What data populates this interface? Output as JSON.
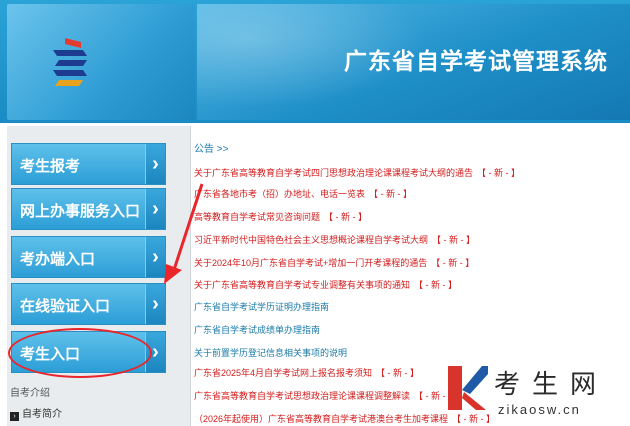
{
  "header": {
    "title": "广东省自学考试管理系统"
  },
  "sidebar": {
    "buttons": [
      {
        "label": "考生报考"
      },
      {
        "label": "网上办事服务入口"
      },
      {
        "label": "考办端入口"
      },
      {
        "label": "在线验证入口"
      },
      {
        "label": "考生入口"
      }
    ],
    "section_label": "自考介绍",
    "link_label": "自考简介"
  },
  "notices": {
    "heading": "公告 >>",
    "items": [
      {
        "text": "关于广东省高等教育自学考试四门思想政治理论课课程考试大纲的通告",
        "tag": "【 - 新 - 】",
        "color": "red"
      },
      {
        "text": "广东省各地市考（招）办地址、电话一览表",
        "tag": "【 - 新 - 】",
        "color": "red"
      },
      {
        "text": "高等教育自学考试常见咨询问题",
        "tag": "【 - 新 - 】",
        "color": "red"
      },
      {
        "text": "习近平新时代中国特色社会主义思想概论课程自学考试大纲",
        "tag": "【 - 新 - 】",
        "color": "red"
      },
      {
        "text": "关于2024年10月广东省自学考试+增加一门开考课程的通告",
        "tag": "【 - 新 - 】",
        "color": "red"
      },
      {
        "text": "关于广东省高等教育自学考试专业调整有关事项的通知",
        "tag": "【 - 新 - 】",
        "color": "red"
      },
      {
        "text": "广东省自学考试学历证明办理指南",
        "tag": "",
        "color": "teal"
      },
      {
        "text": "广东省自学考试成绩单办理指南",
        "tag": "",
        "color": "teal"
      },
      {
        "text": "关于前置学历登记信息相关事项的说明",
        "tag": "",
        "color": "teal"
      },
      {
        "text": "广东省2025年4月自学考试网上报名报考须知",
        "tag": "【 - 新 - 】",
        "color": "red"
      },
      {
        "text": "广东省高等教育自学考试思想政治理论课课程调整解读",
        "tag": "【 - 新 - 】",
        "color": "red"
      },
      {
        "text": "（2026年起使用）广东省高等教育自学考试港澳台考生加考课程",
        "tag": "【 - 新 - 】",
        "color": "red"
      }
    ]
  },
  "watermark": {
    "brand": "考生网",
    "url": "zikaosw.cn"
  },
  "colors": {
    "header": "#1a8bc4",
    "notice_red": "#d21d1d",
    "notice_teal": "#1a7ba8",
    "annotation": "#e8262b"
  }
}
